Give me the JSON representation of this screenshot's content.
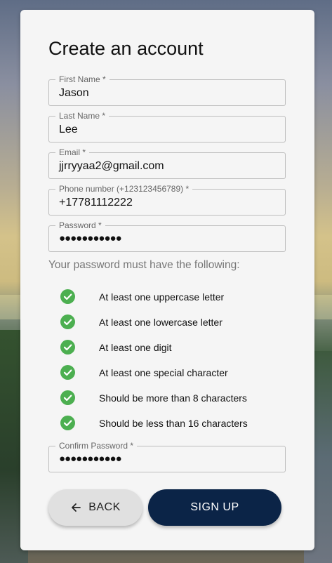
{
  "form": {
    "title": "Create an account",
    "fields": [
      {
        "label": "First Name *",
        "value": "Jason"
      },
      {
        "label": "Last Name *",
        "value": "Lee"
      },
      {
        "label": "Email *",
        "value": "jjrryyaa2@gmail.com"
      },
      {
        "label": "Phone number (+123123456789) *",
        "value": "+17781112222"
      },
      {
        "label": "Password *",
        "value": "●●●●●●●●●●●",
        "masked": true
      },
      {
        "label": "Confirm Password *",
        "value": "●●●●●●●●●●●",
        "masked": true
      }
    ],
    "password_rules_intro": "Your password must have the following:",
    "password_rules": [
      {
        "text": "At least one uppercase letter",
        "met": true
      },
      {
        "text": "At least one lowercase letter",
        "met": true
      },
      {
        "text": "At least one digit",
        "met": true
      },
      {
        "text": "At least one special character",
        "met": true
      },
      {
        "text": "Should be more than 8 characters",
        "met": true
      },
      {
        "text": "Should be less than 16 characters",
        "met": true
      }
    ],
    "back_label": "BACK",
    "back_icon": "arrow-left-icon",
    "signup_label": "SIGN UP",
    "rule_icon": "check-circle-icon"
  },
  "colors": {
    "card_bg": "#f5f5f5",
    "check": "#4caf50",
    "primary": "#0b2447",
    "secondary_button": "#e0e0e0"
  }
}
